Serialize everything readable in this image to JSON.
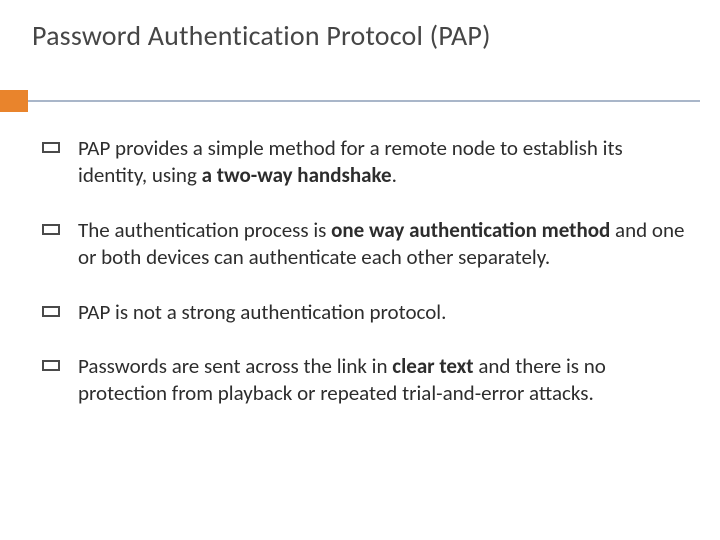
{
  "title": "Password Authentication Protocol (PAP)",
  "bullets": {
    "b1": {
      "pre": "PAP provides a simple method for a remote node to establish its identity, using ",
      "bold": "a two-way handshake",
      "post": "."
    },
    "b2": {
      "pre": "The authentication process is ",
      "bold": "one way authentication method",
      "post": " and one or both devices can authenticate each other separately."
    },
    "b3": {
      "plain": "PAP is not a strong authentication protocol."
    },
    "b4": {
      "pre": "Passwords are sent across the link in ",
      "bold": "clear text",
      "post": " and there is no protection from playback or repeated trial-and-error attacks."
    }
  }
}
